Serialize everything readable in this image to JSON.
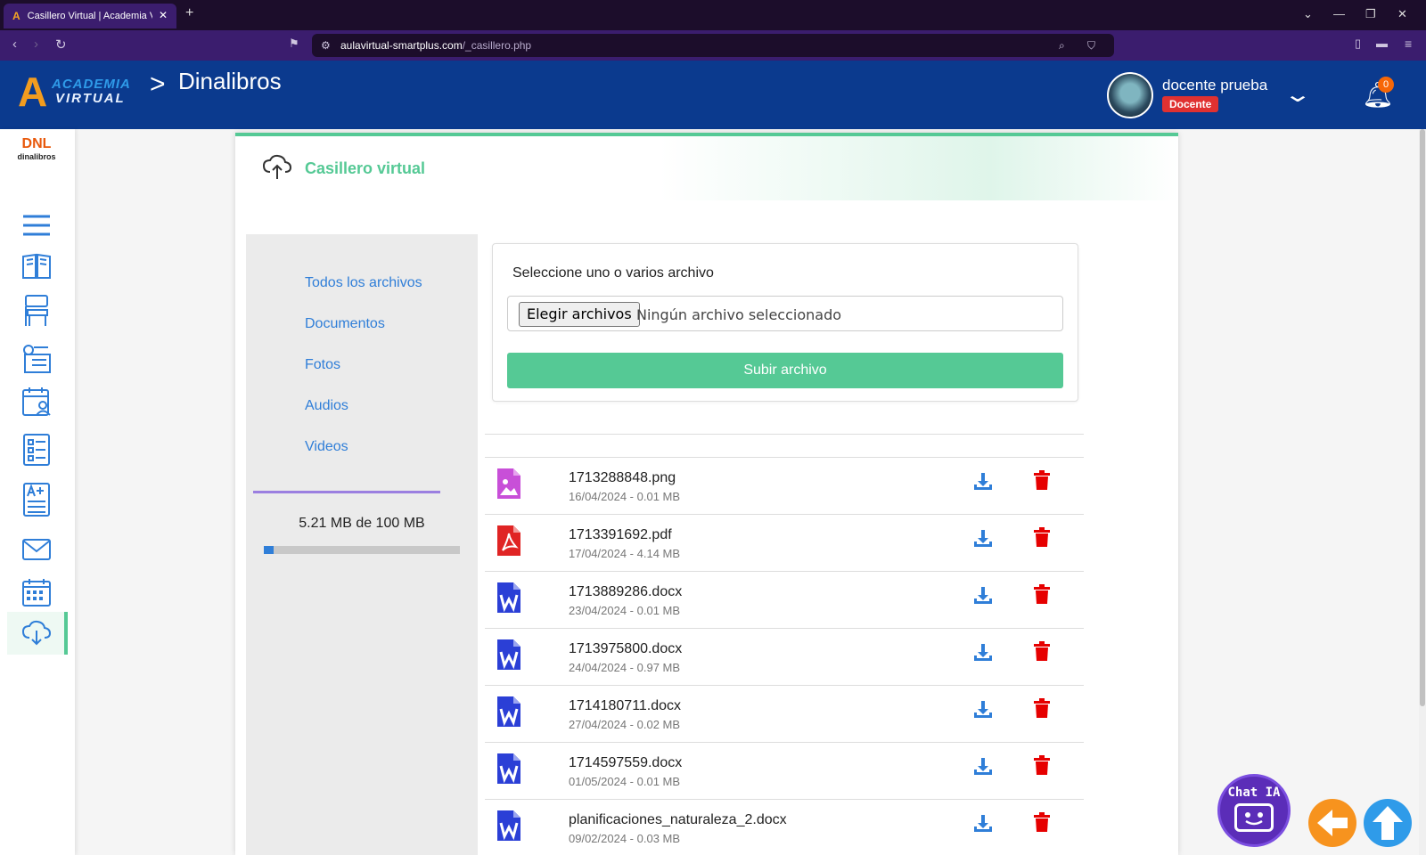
{
  "browser": {
    "tab_title": "Casillero Virtual | Academia Vir",
    "tab_favicon": "A",
    "new_tab": "+",
    "url_domain": "aulavirtual-smartplus.com",
    "url_path": "/_casillero.php"
  },
  "header": {
    "logo_mark": "A",
    "logo_line1": "ACADEMIA",
    "logo_line2": "VIRTUAL",
    "breadcrumb_sep": ">",
    "title": "Dinalibros",
    "user_name": "docente prueba",
    "user_role": "Docente",
    "notifications_count": "0"
  },
  "sidebar": {
    "school_mark": "DNL",
    "school_name": "dinalibros",
    "items": [
      {
        "icon": "menu-icon"
      },
      {
        "icon": "book-icon"
      },
      {
        "icon": "desk-icon"
      },
      {
        "icon": "schedule-icon"
      },
      {
        "icon": "calendar-user-icon"
      },
      {
        "icon": "checklist-icon"
      },
      {
        "icon": "grades-icon"
      },
      {
        "icon": "mail-icon"
      },
      {
        "icon": "calendar-icon"
      },
      {
        "icon": "cloud-download-icon",
        "active": true
      }
    ]
  },
  "locker": {
    "title": "Casillero virtual",
    "filters": [
      "Todos los archivos",
      "Documentos",
      "Fotos",
      "Audios",
      "Videos"
    ],
    "quota_text": "5.21 MB de 100 MB",
    "quota_used_fraction": 0.0521,
    "upload_label": "Seleccione uno o varios archivo",
    "choose_button": "Elegir archivos",
    "no_file_text": "Ningún archivo seleccionado",
    "submit_button": "Subir archivo",
    "files": [
      {
        "name": "1713288848.png",
        "meta": "16/04/2024 - 0.01 MB",
        "type": "image"
      },
      {
        "name": "1713391692.pdf",
        "meta": "17/04/2024 - 4.14 MB",
        "type": "pdf"
      },
      {
        "name": "1713889286.docx",
        "meta": "23/04/2024 - 0.01 MB",
        "type": "word"
      },
      {
        "name": "1713975800.docx",
        "meta": "24/04/2024 - 0.97 MB",
        "type": "word"
      },
      {
        "name": "1714180711.docx",
        "meta": "27/04/2024 - 0.02 MB",
        "type": "word"
      },
      {
        "name": "1714597559.docx",
        "meta": "01/05/2024 - 0.01 MB",
        "type": "word"
      },
      {
        "name": "planificaciones_naturaleza_2.docx",
        "meta": "09/02/2024 - 0.03 MB",
        "type": "word"
      }
    ]
  },
  "floating": {
    "chat_label": "Chat IA"
  },
  "colors": {
    "header_bg": "#0b3a8e",
    "accent_green": "#55c995",
    "link_blue": "#2f7ed8",
    "delete_red": "#e03131"
  }
}
